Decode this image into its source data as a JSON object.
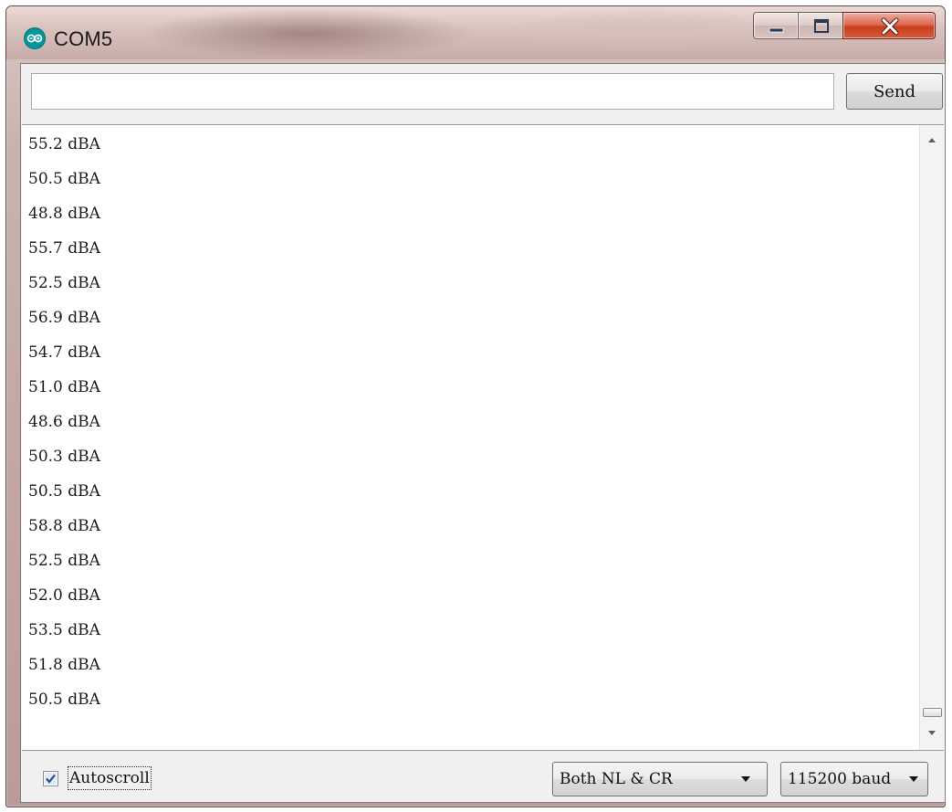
{
  "window": {
    "title": "COM5",
    "app_icon": "arduino-infinity-icon",
    "controls": {
      "minimize_icon": "minimize-icon",
      "maximize_icon": "maximize-icon",
      "close_icon": "close-icon"
    },
    "accent_close_color": "#c7401f"
  },
  "input": {
    "value": "",
    "placeholder": ""
  },
  "send_button": {
    "label": "Send"
  },
  "output_lines": [
    "55.2 dBA",
    "50.5 dBA",
    "48.8 dBA",
    "55.7 dBA",
    "52.5 dBA",
    "56.9 dBA",
    "54.7 dBA",
    "51.0 dBA",
    "48.6 dBA",
    "50.3 dBA",
    "50.5 dBA",
    "58.8 dBA",
    "52.5 dBA",
    "52.0 dBA",
    "53.5 dBA",
    "51.8 dBA",
    "50.5 dBA"
  ],
  "scrollbar": {
    "up_icon": "scroll-up-arrow-icon",
    "down_icon": "scroll-down-arrow-icon",
    "position": 1.0
  },
  "footer": {
    "autoscroll": {
      "label": "Autoscroll",
      "checked": true
    },
    "line_ending": {
      "selected": "Both NL & CR"
    },
    "baud_rate": {
      "selected": "115200 baud"
    }
  }
}
